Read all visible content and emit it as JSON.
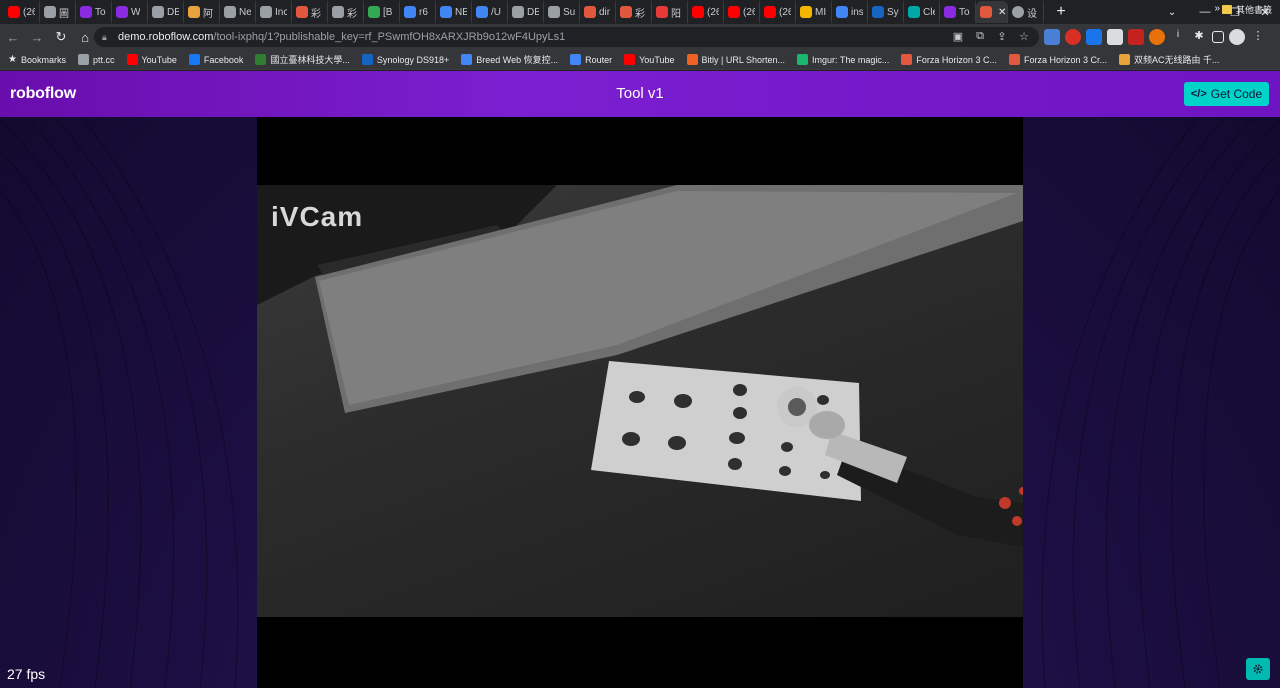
{
  "browser": {
    "tabs": [
      {
        "label": "(26",
        "color": "#ff0000"
      },
      {
        "label": "圖",
        "color": "#9aa0a6"
      },
      {
        "label": "To",
        "color": "#8a2be2"
      },
      {
        "label": "W",
        "color": "#8a2be2"
      },
      {
        "label": "DE",
        "color": "#9aa0a6"
      },
      {
        "label": "阿",
        "color": "#e8a33d"
      },
      {
        "label": "Ne",
        "color": "#9aa0a6"
      },
      {
        "label": "Inc",
        "color": "#9aa0a6"
      },
      {
        "label": "彩",
        "color": "#e2583e"
      },
      {
        "label": "彩",
        "color": "#9aa0a6"
      },
      {
        "label": "[B",
        "color": "#34a853"
      },
      {
        "label": "r6",
        "color": "#4285f4"
      },
      {
        "label": "NE",
        "color": "#4285f4"
      },
      {
        "label": "/U",
        "color": "#4285f4"
      },
      {
        "label": "DE",
        "color": "#9aa0a6"
      },
      {
        "label": "Su",
        "color": "#9aa0a6"
      },
      {
        "label": "dir",
        "color": "#e2583e"
      },
      {
        "label": "彩",
        "color": "#e2583e"
      },
      {
        "label": "阳",
        "color": "#e53935"
      },
      {
        "label": "(26",
        "color": "#ff0000"
      },
      {
        "label": "(26",
        "color": "#ff0000"
      },
      {
        "label": "(26",
        "color": "#ff0000"
      },
      {
        "label": "MI",
        "color": "#f4b400"
      },
      {
        "label": "ins",
        "color": "#4285f4"
      },
      {
        "label": "Sy",
        "color": "#1565c0"
      },
      {
        "label": "Cle",
        "color": "#00a8a8"
      },
      {
        "label": "To",
        "color": "#8a2be2"
      }
    ],
    "active_tab_label": "F",
    "settings_tab_label": "设",
    "url_host": "demo.roboflow.com",
    "url_path": "/tool-ixphq/1?publishable_key=rf_PSwmfOH8xARXJRb9o12wF4UpyLs1",
    "bookmarks_label": "Bookmarks",
    "bookmarks": [
      {
        "label": "ptt.cc",
        "color": "#9aa0a6"
      },
      {
        "label": "YouTube",
        "color": "#ff0000"
      },
      {
        "label": "Facebook",
        "color": "#1877f2"
      },
      {
        "label": "國立臺林科技大學...",
        "color": "#2e7d32"
      },
      {
        "label": "Synology DS918+",
        "color": "#1565c0"
      },
      {
        "label": "Breed Web 恢复控...",
        "color": "#4285f4"
      },
      {
        "label": "Router",
        "color": "#4285f4"
      },
      {
        "label": "YouTube",
        "color": "#ff0000"
      },
      {
        "label": "Bitly | URL Shorten...",
        "color": "#ee6123"
      },
      {
        "label": "Imgur: The magic...",
        "color": "#1bb76e"
      },
      {
        "label": "Forza Horizon 3 C...",
        "color": "#e2583e"
      },
      {
        "label": "Forza Horizon 3 Cr...",
        "color": "#e2583e"
      },
      {
        "label": "双频AC无线路由 千...",
        "color": "#e8a33d"
      }
    ],
    "other_bookmarks_label": "其他書籤"
  },
  "app": {
    "logo": "roboflow",
    "title": "Tool v1",
    "get_code_label": "Get Code",
    "watermark": "iVCam",
    "fps_label": "27 fps"
  },
  "colors": {
    "header_purple": "#6a0dad",
    "accent_teal": "#00d4c8",
    "background_dark": "#120a2e"
  }
}
